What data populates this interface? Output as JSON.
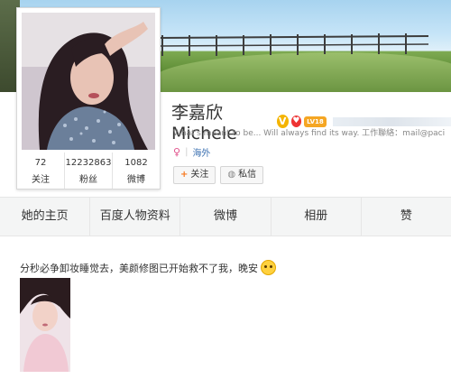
{
  "profile": {
    "name": "李嘉欣Michele",
    "v_badge": "V",
    "heart_badge": "♥",
    "level_badge": "LV18",
    "intro": "What's meant to be... Will always find its way. 工作聯絡：mail@paci",
    "location": "海外",
    "stats": [
      {
        "value": "72",
        "label": "关注"
      },
      {
        "value": "12232863",
        "label": "粉丝"
      },
      {
        "value": "1082",
        "label": "微博"
      }
    ]
  },
  "buttons": {
    "follow": "关注",
    "follow_icon": "+",
    "message": "私信",
    "message_icon": "◍"
  },
  "tabs": [
    "她的主页",
    "百度人物资料",
    "微博",
    "相册",
    "赞"
  ],
  "post": {
    "text": "分秒必争卸妆睡觉去，美颜修图已开始救不了我，晚安"
  },
  "colors": {
    "link": "#3a6fb0",
    "follow_plus": "#f7781f",
    "badge_gold": "#f4b400"
  }
}
